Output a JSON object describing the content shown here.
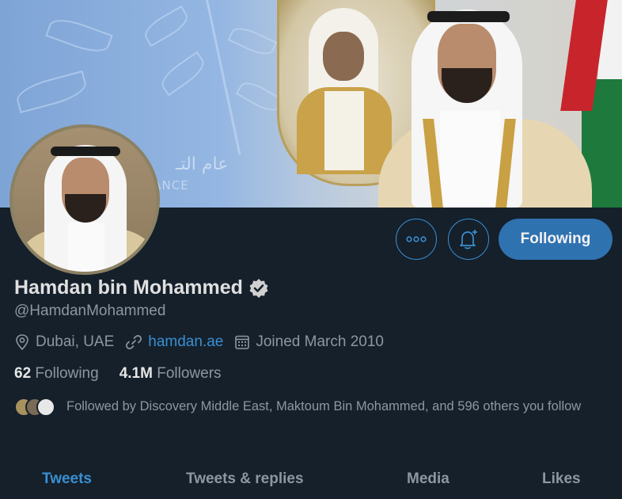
{
  "banner": {
    "arabic_text": "عام التـ",
    "latin_text": "ERANCE"
  },
  "actions": {
    "more_icon": "more-horizontal-icon",
    "notify_icon": "bell-plus-icon",
    "following_label": "Following"
  },
  "profile": {
    "name": "Hamdan bin Mohammed",
    "handle": "@HamdanMohammed",
    "location": "Dubai, UAE",
    "website": "hamdan.ae",
    "joined": "Joined March 2010",
    "following_count": "62",
    "following_label": "Following",
    "followers_count": "4.1M",
    "followers_label": "Followers",
    "followed_by": "Followed by Discovery Middle East, Maktoum Bin Mohammed, and 596 others you follow"
  },
  "tabs": [
    {
      "label": "Tweets",
      "active": true
    },
    {
      "label": "Tweets & replies",
      "active": false
    },
    {
      "label": "Media",
      "active": false
    },
    {
      "label": "Likes",
      "active": false
    }
  ],
  "colors": {
    "background": "#15202b",
    "accent": "#3a8fd1",
    "muted": "#8c97a2"
  }
}
